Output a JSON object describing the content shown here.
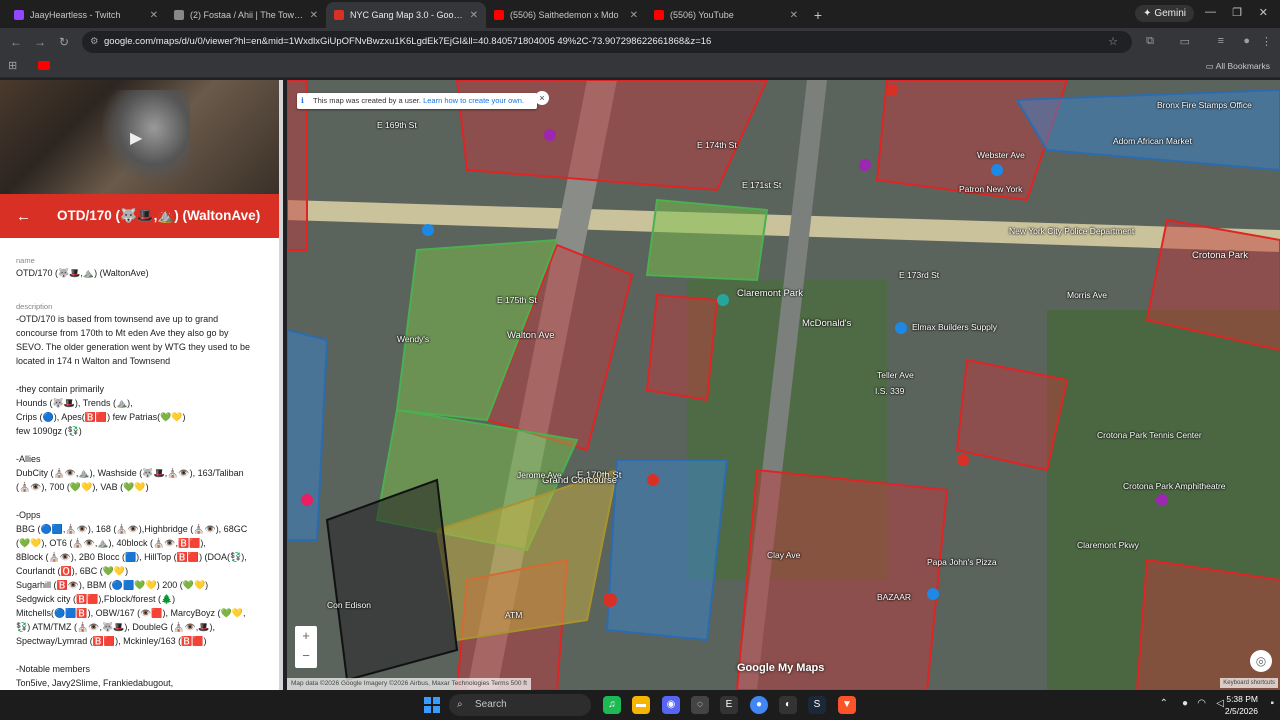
{
  "browser": {
    "tabs": [
      {
        "label": "JaayHeartless - Twitch",
        "color": "#9146ff",
        "active": false
      },
      {
        "label": "(2) Fostaa / Ahii | The Towns Ro",
        "color": "#888888",
        "active": false
      },
      {
        "label": "NYC Gang Map 3.0 - Google M",
        "color": "#d93025",
        "active": true
      },
      {
        "label": "(5506) Saithedemon x Mdo",
        "color": "#ff0000",
        "active": false
      },
      {
        "label": "(5506) YouTube",
        "color": "#ff0000",
        "active": false
      }
    ],
    "gemini_label": "Gemini",
    "url": "google.com/maps/d/u/0/viewer?hl=en&mid=1WxdlxGiUpOFNvBwzxu1K6LgdEk7EjGI&ll=40.840571804005 49%2C-73.907298622661868&z=16",
    "all_bookmarks": "All Bookmarks"
  },
  "sidebar": {
    "header_title": "OTD/170 (🐺🎩,⛰️) (WaltonAve)",
    "name_label": "name",
    "name_value": "OTD/170 (🐺🎩,⛰️) (WaltonAve)",
    "description_label": "description",
    "description": [
      "-OTD/170 is based from townsend ave up to grand",
      "concourse from 170th to Mt eden Ave they also go by",
      "SEVO. The older generation went by WTG they used to be",
      "located in 174 n Walton and Townsend",
      "",
      "-they contain primarily",
      "Hounds (🐺🎩), Trends (⛰️),",
      "Crips (🔵), Apes(🅱️🟥) few Patrias(💚💛)",
      "few 1090gz (💱)",
      "",
      "-Allies",
      "DubCity (⛪👁️,⛰️), Washside (🐺🎩,⛪👁️), 163/Taliban",
      "(⛪👁️), 700 (💚💛), VAB (💚💛)",
      "",
      "-Opps",
      "BBG (🔵🟦,⛪👁️), 168 (⛪👁️),Highbridge (⛪👁️), 68GC",
      "(💚💛), OT6 (⛪👁️,⛰️), 40block (⛪👁️,🅱️🟥),",
      "8Block (⛪👁️), 2B0 Blocc (🟦), HillTop (🅱️🟥) (DOA(💱),",
      "Courlandt (🅾️), 6BC (💚💛)",
      "Sugarhill (🅱️👁️), BBM (🔵🟦💚💛) 200 (💚💛)",
      "Sedgwick city (🅱️🟥),Fblock/forest (🌲)",
      "Mitchells(🔵🟦🅱️), OBW/167 (👁️🟥), MarcyBoyz (💚💛,",
      "💱) ATM/TMZ (⛪👁️,🐺🎩), DoubleG (⛪👁️,🎩),",
      "Spectway/Lymrad (🅱️🟥), Mckinley/163 (🅱️🟥)",
      "",
      "-Notable members",
      "Ton5ive, Javy2Slime, Frankiedabugout,"
    ]
  },
  "map": {
    "notice_text": "This map was created by a user.",
    "notice_link": "Learn how to create your own.",
    "labels": [
      "E 170th St",
      "Grand Concourse",
      "Walton Ave",
      "Claremont Park",
      "McDonald's",
      "Crotona Park",
      "New York City Police Department",
      "Bronx Fire Stamps Office",
      "Adom African Market",
      "Webster Ave",
      "Clay Ave",
      "E 173rd St",
      "E 174th St",
      "Papa John's Pizza",
      "Claremont Pkwy",
      "Crotona Park Amphitheatre",
      "Elmax Builders Supply",
      "Wendy's",
      "Con Edison",
      "Patron New York",
      "Jerome Ave",
      "E 175th St",
      "Morris Ave",
      "Teller Ave",
      "I.S. 339",
      "Crotona Park Tennis Center",
      "ATM",
      "BAZAAR",
      "E 169th St",
      "E 171st St"
    ],
    "branding": "Google My Maps",
    "attribution": "Map data ©2026 Google Imagery ©2026 Airbus, Maxar Technologies   Terms   500 ft",
    "keyboard": "Keyboard shortcuts"
  },
  "taskbar": {
    "search_placeholder": "Search",
    "time": "5:38 PM",
    "date": "2/5/2026"
  }
}
